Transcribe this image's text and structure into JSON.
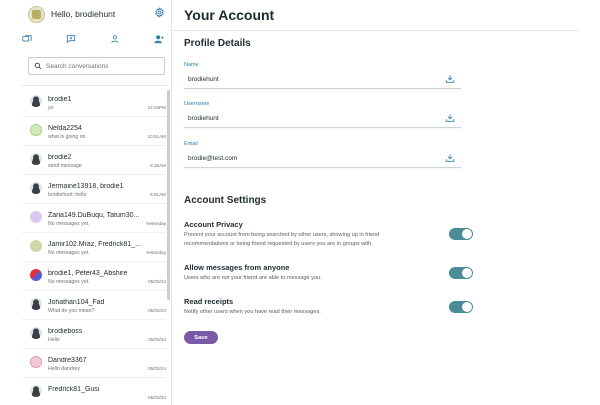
{
  "sidebar": {
    "greeting": "Hello, brodiehunt",
    "search_placeholder": "Search conversations",
    "icons": [
      "chats-icon",
      "new-message-icon",
      "profile-icon",
      "add-friend-icon"
    ],
    "conversations": [
      {
        "name": "brodie1",
        "message": "yo",
        "time": "12:34PM",
        "avatar": "person"
      },
      {
        "name": "Nelda2254",
        "message": "what is going on",
        "time": "10:51AM",
        "avatar": "green"
      },
      {
        "name": "brodie2",
        "message": "send message",
        "time": "8:26AM",
        "avatar": "person"
      },
      {
        "name": "Jermaine13918, brodie1",
        "message": "brodiehunt: hello",
        "time": "5:51AM",
        "avatar": "person"
      },
      {
        "name": "Zaria149.DuBuqu, Tatum30...",
        "message": "No messages yet.",
        "time": "Yesterday",
        "avatar": "purple"
      },
      {
        "name": "Jamir102.Mraz, Fredrick81_...",
        "message": "No messages yet.",
        "time": "Yesterday",
        "avatar": "olive"
      },
      {
        "name": "brodie1, Peter43_Abshire",
        "message": "No messages yet.",
        "time": "05/03/24",
        "avatar": "multi"
      },
      {
        "name": "Johathan104_Fad",
        "message": "What do you mean?",
        "time": "05/03/24",
        "avatar": "person"
      },
      {
        "name": "brodieboss",
        "message": "Hello",
        "time": "05/03/24",
        "avatar": "person"
      },
      {
        "name": "Dandre3367",
        "message": "Hello dandrey",
        "time": "05/03/24",
        "avatar": "pink"
      },
      {
        "name": "Fredrick81_Gusi",
        "message": "",
        "time": "05/03/24",
        "avatar": "person"
      }
    ]
  },
  "main": {
    "title": "Your Account",
    "profile_section": "Profile Details",
    "fields": [
      {
        "label": "Name",
        "value": "brodiehunt"
      },
      {
        "label": "Username",
        "value": "brodiehunt"
      },
      {
        "label": "Email",
        "value": "brodie@test.com"
      }
    ],
    "settings_section": "Account Settings",
    "settings": [
      {
        "title": "Account Privacy",
        "description": "Prevent your account from being searched by other users, showing up in friend recommendations or being friend requested by users you are in groups with.",
        "enabled": true
      },
      {
        "title": "Allow messages from anyone",
        "description": "Users who are not your friend are able to message you.",
        "enabled": true
      },
      {
        "title": "Read receipts",
        "description": "Notify other users when you have read their messages.",
        "enabled": true
      }
    ],
    "save_label": "Save"
  },
  "colors": {
    "accent_teal": "#4a8c97",
    "save_purple": "#7a5aa8",
    "label_blue": "#2f7fa6"
  }
}
